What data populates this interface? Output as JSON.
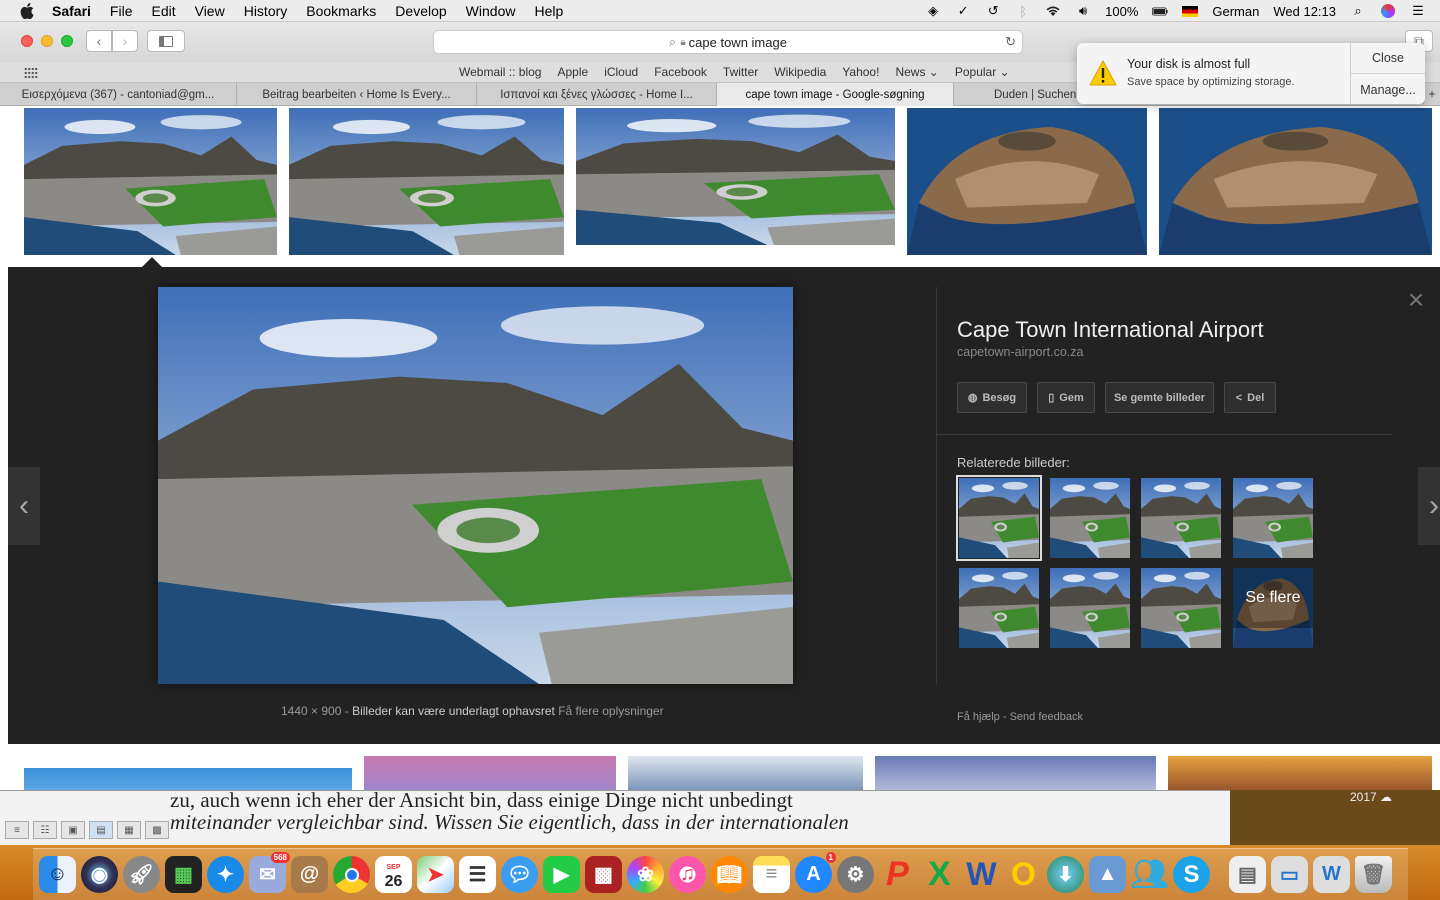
{
  "menubar": {
    "app": "Safari",
    "items": [
      "File",
      "Edit",
      "View",
      "History",
      "Bookmarks",
      "Develop",
      "Window",
      "Help"
    ],
    "battery": "100%",
    "input_source": "German",
    "clock": "Wed 12:13"
  },
  "toolbar": {
    "url": "cape town image"
  },
  "bookmarks": [
    "Webmail :: blog",
    "Apple",
    "iCloud",
    "Facebook",
    "Twitter",
    "Wikipedia",
    "Yahoo!",
    "News ⌄",
    "Popular ⌄"
  ],
  "tabs": [
    {
      "label": "Εισερχόμενα (367) - cantoniad@gm..."
    },
    {
      "label": "Beitrag bearbeiten ‹ Home Is Every..."
    },
    {
      "label": "Ισπανοί και ξένες γλώσσες - Home I..."
    },
    {
      "label": "cape town image - Google-søgning"
    },
    {
      "label": "Duden | Suchen"
    }
  ],
  "notification": {
    "title": "Your disk is almost full",
    "body": "Save space by optimizing storage.",
    "close": "Close",
    "manage": "Manage..."
  },
  "preview": {
    "title": "Cape Town International Airport",
    "source": "capetown-airport.co.za",
    "buttons": {
      "visit": "Besøg",
      "save": "Gem",
      "saved": "Se gemte billeder",
      "share": "Del"
    },
    "related_label": "Relaterede billeder:",
    "more": "Se flere",
    "dimensions": "1440 × 900",
    "copyright": "Billeder kan være underlagt ophavsret",
    "more_info": "Få flere oplysninger",
    "help": "Få hjælp",
    "feedback": "Send feedback"
  },
  "background_doc": {
    "line1": "zu, auch wenn ich eher der Ansicht bin, dass einige Dinge nicht unbedingt",
    "line2": "miteinander vergleichbar sind. Wissen Sie eigentlich, dass in der internationalen",
    "year": "2017"
  },
  "dock": {
    "calendar_month": "SEP",
    "calendar_day": "26",
    "mail_badge": "568",
    "appstore_badge": "1"
  },
  "colors": {
    "panel_bg": "#222222",
    "dock_bg": "#c87a1a"
  }
}
